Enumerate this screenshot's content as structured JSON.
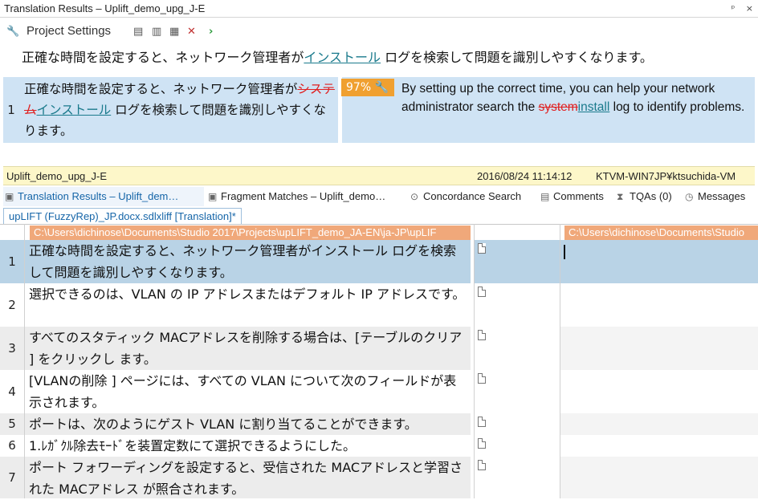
{
  "window": {
    "title": "Translation Results – Uplift_demo_upg_J-E",
    "pin": "ᵖ",
    "close": "×"
  },
  "toolbar": {
    "project_settings": "Project Settings"
  },
  "source_line": {
    "pre": "正確な時間を設定すると、ネットワーク管理者が",
    "ins": "インストール",
    "post": " ログを検索して問題を識別しやすくなります。"
  },
  "translation_result": {
    "number": "1",
    "src_pre": "正確な時間を設定すると、ネットワーク管理者が",
    "src_del": "システム",
    "src_ins": "インストール",
    "src_post": " ログを検索して問題を識別しやすくなります。",
    "match": "97%",
    "tgt_pre": "By setting up the correct time, you can help your network administrator search the ",
    "tgt_del": "system",
    "tgt_ins": "install",
    "tgt_post": " log to identify problems."
  },
  "status": {
    "tm_name": "Uplift_demo_upg_J-E",
    "date": "2016/08/24 11:14:12",
    "user": "KTVM-WIN7JP¥ktsuchida-VM"
  },
  "tabs": [
    {
      "label": "Translation Results – Uplift_dem…",
      "icon": "translation-results-icon"
    },
    {
      "label": "Fragment Matches – Uplift_demo…",
      "icon": "fragment-matches-icon"
    },
    {
      "label": "Concordance Search",
      "icon": "binoculars-icon"
    },
    {
      "label": "Comments",
      "icon": "comments-icon"
    },
    {
      "label": "TQAs (0)",
      "icon": "tqa-icon"
    },
    {
      "label": "Messages",
      "icon": "messages-icon"
    }
  ],
  "document_tab": "upLIFT (FuzzyRep)_JP.docx.sdlxliff [Translation]*",
  "columns": {
    "source_path": "C:\\Users\\dichinose\\Documents\\Studio 2017\\Projects\\upLIFT_demo_JA-EN\\ja-JP\\upLIF",
    "target_path": "C:\\Users\\dichinose\\Documents\\Studio"
  },
  "segments": [
    {
      "n": "1",
      "src": "正確な時間を設定すると、ネットワーク管理者がインストール ログを検索して問題を識別しやすくなります。",
      "tgt": ""
    },
    {
      "n": "2",
      "src": "選択できるのは、VLAN の IP アドレスまたはデフォルト IP アドレスです。",
      "tgt": ""
    },
    {
      "n": "3",
      "src": "すべてのスタティック MACアドレスを削除する場合は、[テーブルのクリア ] をクリックし ます。",
      "tgt": ""
    },
    {
      "n": "4",
      "src": "[VLANの削除 ] ページには、すべての VLAN について次のフィールドが表示されます。",
      "tgt": ""
    },
    {
      "n": "5",
      "src": "ポートは、次のようにゲスト VLAN に割り当てることができます。",
      "tgt": ""
    },
    {
      "n": "6",
      "src": "1.ﾚｶﾞｸﾙ除去ﾓｰﾄﾞを装置定数にて選択できるようにした。",
      "tgt": ""
    },
    {
      "n": "7",
      "src": "ポート フォワーディングを設定すると、受信された MACアドレスと学習された MACアドレス が照合されます。",
      "tgt": ""
    }
  ]
}
